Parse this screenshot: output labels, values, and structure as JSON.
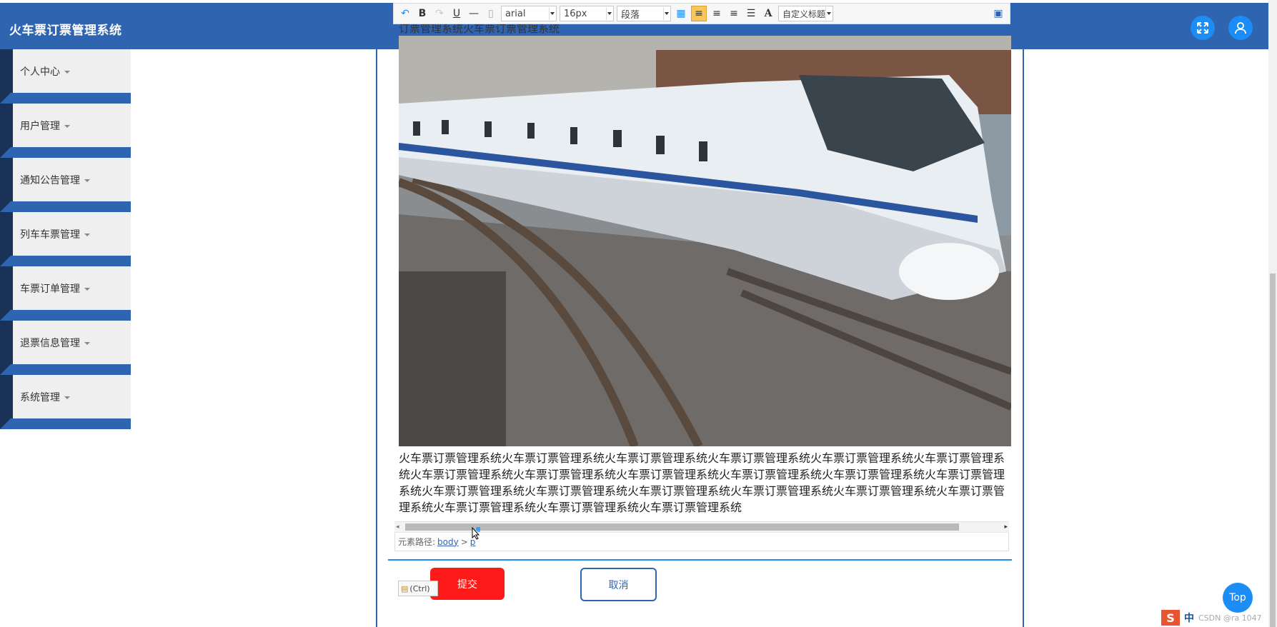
{
  "app": {
    "title": "火车票订票管理系统"
  },
  "header": {
    "fullscreen_icon": "expand-icon",
    "user_icon": "user-icon"
  },
  "sidebar": {
    "items": [
      {
        "label": "个人中心"
      },
      {
        "label": "用户管理"
      },
      {
        "label": "通知公告管理"
      },
      {
        "label": "列车车票管理"
      },
      {
        "label": "车票订单管理"
      },
      {
        "label": "退票信息管理"
      },
      {
        "label": "系统管理"
      }
    ]
  },
  "editor": {
    "font_family": "arial",
    "font_size": "16px",
    "paragraph": "段落",
    "custom_title": "自定义标题",
    "top_text": "订票管理系统火车票订票管理系统",
    "body_text": "火车票订票管理系统火车票订票管理系统火车票订票管理系统火车票订票管理系统火车票订票管理系统火车票订票管理系统火车票订票管理系统火车票订票管理系统火车票订票管理系统火车票订票管理系统火车票订票管理系统火车票订票管理系统火车票订票管理系统火车票订票管理系统火车票订票管理系统火车票订票管理系统火车票订票管理系统火车票订票管理系统火车票订票管理系统火车票订票管理系统火车票订票管理系统",
    "element_path_label": "元素路径:",
    "element_path": [
      "body",
      "p"
    ],
    "element_path_sep": ">"
  },
  "paste_tip": "(Ctrl)",
  "actions": {
    "submit": "提交",
    "cancel": "取消"
  },
  "top_button": "Top",
  "tray": {
    "logo": "S",
    "ime": "中",
    "watermark": "CSDN @ra 1047"
  },
  "colors": {
    "primary": "#2f64b1",
    "accent": "#1c8df5",
    "danger": "#ff1a1a",
    "sidebar_dark": "#1a3258"
  }
}
